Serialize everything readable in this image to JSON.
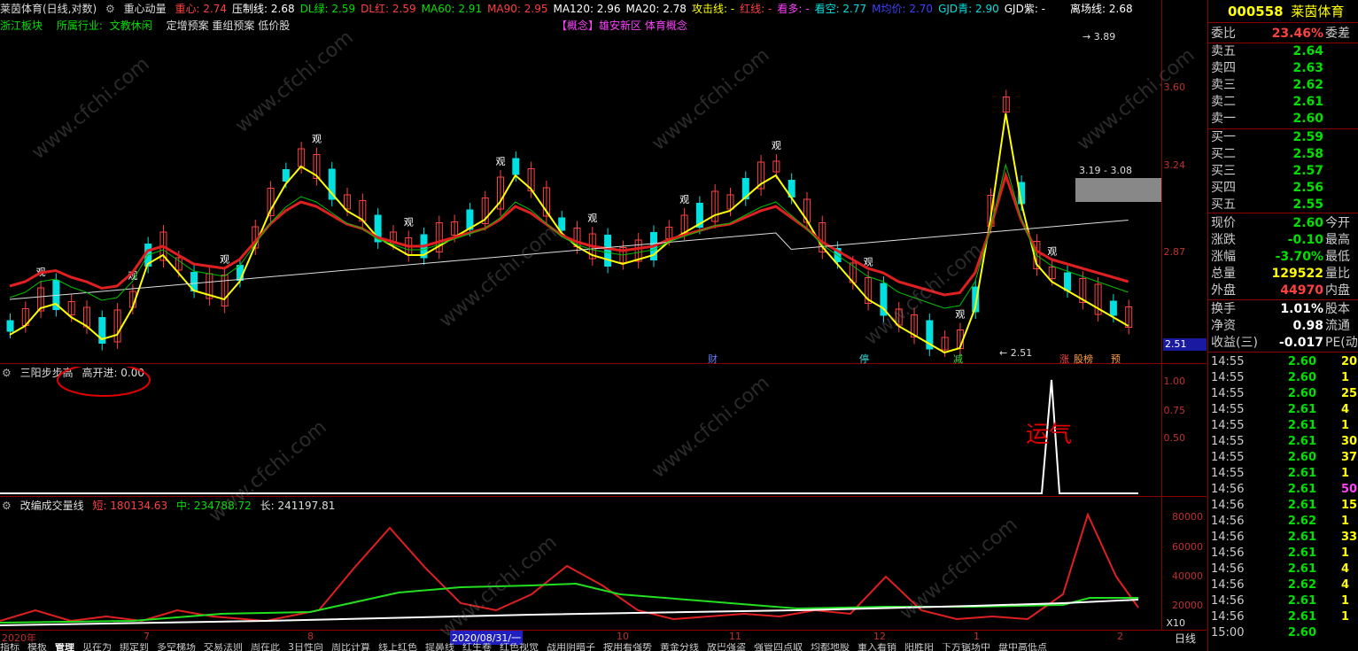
{
  "main_header": {
    "title": "莱茵体育(日线,对数)",
    "indicator_name": "重心动量",
    "items": [
      {
        "label": "重心: 2.74",
        "color": "#ff4040"
      },
      {
        "label": "压制线: 2.68",
        "color": "#ffffff"
      },
      {
        "label": "DL绿: 2.59",
        "color": "#00e000"
      },
      {
        "label": "DL红: 2.59",
        "color": "#ff4040"
      },
      {
        "label": "MA60: 2.91",
        "color": "#00e000"
      },
      {
        "label": "MA90: 2.95",
        "color": "#ff4040"
      },
      {
        "label": "MA120: 2.96",
        "color": "#ffffff"
      },
      {
        "label": "MA20: 2.78",
        "color": "#ffffff"
      },
      {
        "label": "攻击线: -",
        "color": "#ffff00"
      },
      {
        "label": "红线: -",
        "color": "#ff4040"
      },
      {
        "label": "看多: -",
        "color": "#ff40ff"
      },
      {
        "label": "看空: 2.77",
        "color": "#00e0e0"
      },
      {
        "label": "M均价: 2.70",
        "color": "#4040ff"
      },
      {
        "label": "GJD青: 2.90",
        "color": "#00e0e0"
      },
      {
        "label": "GJD紫: -",
        "color": "#ffffff"
      },
      {
        "label": "离场线: 2.68",
        "color": "#ffffff"
      }
    ]
  },
  "sub_header": {
    "sector": "浙江板块",
    "industry_label": "所属行业:",
    "industry": "文教休闲",
    "tags": "定增预案 重组预案 低价股",
    "concept": "【概念】雄安新区 体育概念"
  },
  "main_chart": {
    "y_ticks": [
      "3.60",
      "3.24",
      "2.87",
      "2.51"
    ],
    "high_label": "3.89",
    "low_label": "2.51",
    "range_label": "3.19 - 3.08",
    "price_tag": "2.51",
    "event_tags": [
      "财",
      "停",
      "减",
      "涨",
      "股榜",
      "预"
    ],
    "marker_text": "观"
  },
  "panel2": {
    "name": "三阳步步高",
    "item": "高开进: 0.00",
    "y_ticks": [
      "1.00",
      "0.75",
      "0.50"
    ],
    "annotation": "运气"
  },
  "panel3": {
    "name": "改编成交量线",
    "short": "短: 180134.63",
    "mid": "中: 234788.72",
    "long": "长: 241197.81",
    "y_ticks": [
      "80000",
      "60000",
      "40000",
      "20000"
    ],
    "x_multiplier": "X10"
  },
  "x_axis": {
    "labels": [
      "2020年",
      "7",
      "8",
      "2020/08/31/一",
      "10",
      "11",
      "12",
      "1",
      "2"
    ],
    "right_label": "日线"
  },
  "bottom_tabs": [
    "指标",
    "模板",
    "管理",
    "见在为",
    "绑定到",
    "多空梯场",
    "交易法则",
    "周在此",
    "3日性向",
    "周比计算",
    "线上红色",
    "提鼻线",
    "红生卷",
    "红色视觉",
    "战用阴暗子",
    "按用看强势",
    "黄金分线",
    "放巴强盗",
    "强管四点取",
    "均都地股",
    "重入看销",
    "阳胜阳",
    "下方锯场中",
    "盘中高低点"
  ],
  "quote": {
    "code": "000558",
    "name": "莱茵体育",
    "weibi_label": "委比",
    "weibi": "23.46%",
    "weicha_label": "委差",
    "sells": [
      {
        "label": "卖五",
        "price": "2.64"
      },
      {
        "label": "卖四",
        "price": "2.63"
      },
      {
        "label": "卖三",
        "price": "2.62"
      },
      {
        "label": "卖二",
        "price": "2.61"
      },
      {
        "label": "卖一",
        "price": "2.60"
      }
    ],
    "buys": [
      {
        "label": "买一",
        "price": "2.59"
      },
      {
        "label": "买二",
        "price": "2.58"
      },
      {
        "label": "买三",
        "price": "2.57"
      },
      {
        "label": "买四",
        "price": "2.56"
      },
      {
        "label": "买五",
        "price": "2.55"
      }
    ],
    "stats": [
      {
        "label": "现价",
        "value": "2.60",
        "right": "今开",
        "color": "#00e000"
      },
      {
        "label": "涨跌",
        "value": "-0.10",
        "right": "最高",
        "color": "#00e000"
      },
      {
        "label": "涨幅",
        "value": "-3.70%",
        "right": "最低",
        "color": "#00e000"
      },
      {
        "label": "总量",
        "value": "129522",
        "right": "量比",
        "color": "#ffff00"
      },
      {
        "label": "外盘",
        "value": "44970",
        "right": "内盘",
        "color": "#ff4040"
      }
    ],
    "stats2": [
      {
        "label": "换手",
        "value": "1.01%",
        "right": "股本",
        "color": "#ffffff"
      },
      {
        "label": "净资",
        "value": "0.98",
        "right": "流通",
        "color": "#ffffff"
      },
      {
        "label": "收益(三)",
        "value": "-0.017",
        "right": "PE(动)",
        "color": "#ffffff"
      }
    ],
    "ticks": [
      {
        "t": "14:55",
        "p": "2.60",
        "q": "20",
        "c": "#ffff00"
      },
      {
        "t": "14:55",
        "p": "2.60",
        "q": "1",
        "c": "#ffff00"
      },
      {
        "t": "14:55",
        "p": "2.60",
        "q": "25",
        "c": "#ffff00"
      },
      {
        "t": "14:55",
        "p": "2.61",
        "q": "4",
        "c": "#ffff00"
      },
      {
        "t": "14:55",
        "p": "2.61",
        "q": "1",
        "c": "#ffff00"
      },
      {
        "t": "14:55",
        "p": "2.61",
        "q": "30",
        "c": "#ffff00"
      },
      {
        "t": "14:55",
        "p": "2.60",
        "q": "37",
        "c": "#ffff00"
      },
      {
        "t": "14:55",
        "p": "2.61",
        "q": "1",
        "c": "#ffff00"
      },
      {
        "t": "14:56",
        "p": "2.61",
        "q": "50",
        "c": "#ff40ff"
      },
      {
        "t": "14:56",
        "p": "2.61",
        "q": "15",
        "c": "#ffff00"
      },
      {
        "t": "14:56",
        "p": "2.62",
        "q": "1",
        "c": "#ffff00"
      },
      {
        "t": "14:56",
        "p": "2.61",
        "q": "33",
        "c": "#ffff00"
      },
      {
        "t": "14:56",
        "p": "2.61",
        "q": "1",
        "c": "#ffff00"
      },
      {
        "t": "14:56",
        "p": "2.61",
        "q": "4",
        "c": "#ffff00"
      },
      {
        "t": "14:56",
        "p": "2.62",
        "q": "4",
        "c": "#ffff00"
      },
      {
        "t": "14:56",
        "p": "2.61",
        "q": "1",
        "c": "#ffff00"
      },
      {
        "t": "14:56",
        "p": "2.61",
        "q": "1",
        "c": "#ffff00"
      },
      {
        "t": "15:00",
        "p": "2.60",
        "q": "",
        "c": "#ffff00"
      }
    ]
  },
  "watermark": "www.cfchi.com"
}
